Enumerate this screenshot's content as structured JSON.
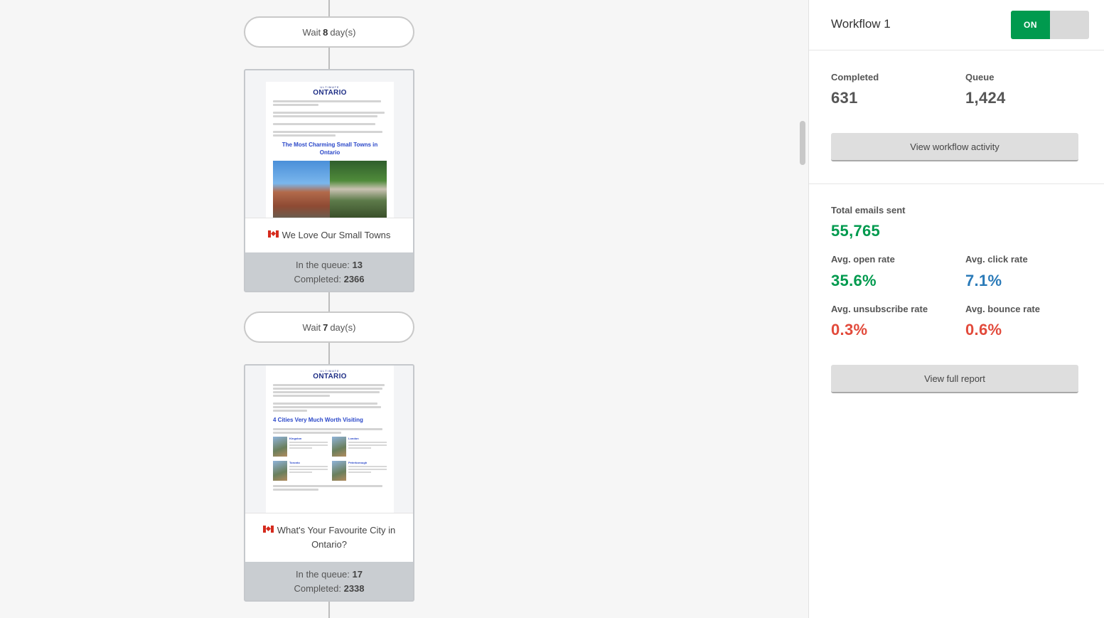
{
  "canvas": {
    "wait_steps": [
      {
        "prefix": "Wait",
        "value": "8",
        "suffix": "day(s)"
      },
      {
        "prefix": "Wait",
        "value": "7",
        "suffix": "day(s)"
      }
    ],
    "emails": [
      {
        "title": "We Love Our Small Towns",
        "flag_icon": "canada-flag-icon",
        "queue_label": "In the queue:",
        "queue_value": "13",
        "completed_label": "Completed:",
        "completed_value": "2366",
        "preview": {
          "logo_small": "ULTIMATE",
          "logo": "ONTARIO",
          "headline": "The Most Charming Small Towns in Ontario"
        }
      },
      {
        "title": "What's Your Favourite City in Ontario?",
        "flag_icon": "canada-flag-icon",
        "queue_label": "In the queue:",
        "queue_value": "17",
        "completed_label": "Completed:",
        "completed_value": "2338",
        "preview": {
          "logo_small": "ULTIMATE",
          "logo": "ONTARIO",
          "headline": "4 Cities Very Much Worth Visiting",
          "cities": [
            "Kingston",
            "London",
            "Toronto",
            "Peterborough"
          ]
        }
      }
    ]
  },
  "sidebar": {
    "workflow_name": "Workflow 1",
    "toggle_label": "ON",
    "completed_label": "Completed",
    "completed_value": "631",
    "queue_label": "Queue",
    "queue_value": "1,424",
    "activity_button": "View workflow activity",
    "total_sent_label": "Total emails sent",
    "total_sent_value": "55,765",
    "open_rate_label": "Avg. open rate",
    "open_rate_value": "35.6%",
    "click_rate_label": "Avg. click rate",
    "click_rate_value": "7.1%",
    "unsub_rate_label": "Avg. unsubscribe rate",
    "unsub_rate_value": "0.3%",
    "bounce_rate_label": "Avg. bounce rate",
    "bounce_rate_value": "0.6%",
    "report_button": "View full report"
  },
  "colors": {
    "green": "#009a4e",
    "blue": "#2a7ab8",
    "red": "#e24a3b"
  }
}
